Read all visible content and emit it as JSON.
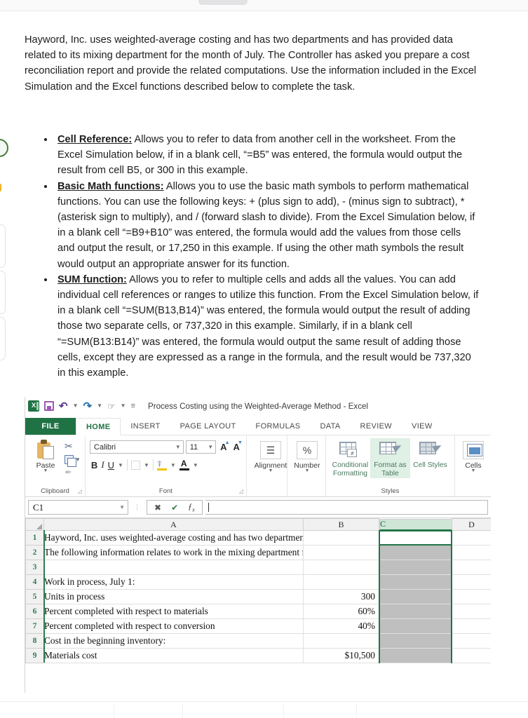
{
  "intro": {
    "paragraph": "Hayword, Inc. uses weighted-average costing and has two departments and has provided data related to its mixing department for the month of July.  The Controller has asked you prepare a cost reconciliation report and provide the related computations.  Use the information included in the Excel Simulation and the Excel functions described below to complete the task."
  },
  "bullets": [
    {
      "term": "Cell Reference:",
      "text": " Allows you to refer to data from another cell in the worksheet.  From the Excel Simulation below, if in a blank cell, “=B5” was entered, the formula would output the result from cell B5, or 300 in this example."
    },
    {
      "term": "Basic Math functions:",
      "text": " Allows you to use the basic math symbols to perform mathematical functions.  You can use the following keys:  + (plus sign to add), - (minus sign to subtract), * (asterisk sign to multiply), and / (forward slash to divide).  From the Excel Simulation below, if in a blank cell “=B9+B10” was entered, the formula would add the values from those cells and output the result, or 17,250 in this example.  If using the other math symbols the result would output an appropriate answer for its function."
    },
    {
      "term": "SUM function:",
      "text": " Allows you to refer to multiple cells and adds all the values.  You can add individual cell references or ranges to utilize this function.  From the Excel Simulation below, if in a blank cell “=SUM(B13,B14)” was entered, the formula would output the result of adding those two separate cells, or 737,320 in this example.  Similarly, if in a blank cell “=SUM(B13:B14)” was entered, the formula would output the same result of adding those cells, except they are expressed as a range in the formula, and the result would be 737,320 in this example."
    }
  ],
  "excel": {
    "title": "Process Costing using the Weighted-Average Method - Excel",
    "quick_access": {
      "app_icon": "excel-icon",
      "save": "save-icon",
      "undo": "undo-icon",
      "redo": "redo-icon",
      "touch_mode": "touch-mode-icon",
      "customize": "customize-icon"
    },
    "tabs": [
      {
        "label": "FILE",
        "active": false,
        "file": true
      },
      {
        "label": "HOME",
        "active": true,
        "file": false
      },
      {
        "label": "INSERT",
        "active": false,
        "file": false
      },
      {
        "label": "PAGE LAYOUT",
        "active": false,
        "file": false
      },
      {
        "label": "FORMULAS",
        "active": false,
        "file": false
      },
      {
        "label": "DATA",
        "active": false,
        "file": false
      },
      {
        "label": "REVIEW",
        "active": false,
        "file": false
      },
      {
        "label": "VIEW",
        "active": false,
        "file": false
      }
    ],
    "ribbon": {
      "clipboard": {
        "group_label": "Clipboard",
        "paste_label": "Paste",
        "cut_icon": "scissors-icon",
        "copy_icon": "copy-icon",
        "format_painter_icon": "format-painter-icon"
      },
      "font": {
        "group_label": "Font",
        "font_name": "Calibri",
        "font_size": "11",
        "grow_font": "A",
        "shrink_font": "A",
        "bold": "B",
        "italic": "I",
        "underline": "U",
        "borders_icon": "borders-icon",
        "fill_color_icon": "fill-color-icon",
        "font_color_icon": "font-color-icon"
      },
      "alignment": {
        "label": "Alignment",
        "icon": "alignment-icon"
      },
      "number": {
        "label": "Number",
        "icon": "percent-icon",
        "symbol": "%"
      },
      "styles": {
        "group_label": "Styles",
        "conditional_formatting": "Conditional Formatting",
        "format_as_table": "Format as Table",
        "cell_styles": "Cell Styles"
      },
      "cells": {
        "label": "Cells",
        "icon": "insert-cells-icon"
      }
    },
    "formula_bar": {
      "name_box": "C1",
      "cancel_icon": "cancel-icon",
      "enter_icon": "enter-icon",
      "insert_function_icon": "fx-icon",
      "value": ""
    },
    "sheet": {
      "columns": [
        "A",
        "B",
        "C",
        "D"
      ],
      "selected_column": "C",
      "active_cell": "C1",
      "rows": [
        {
          "n": "1",
          "a": "Hayword, Inc. uses weighted-average costing and has two departments, mixing and packaging.",
          "b": "",
          "c": "",
          "d": ""
        },
        {
          "n": "2",
          "a": "The following information relates to work in the mixing department for the month of July:",
          "b": "",
          "c": "",
          "d": ""
        },
        {
          "n": "3",
          "a": "",
          "b": "",
          "c": "",
          "d": ""
        },
        {
          "n": "4",
          "a": "Work in process, July 1:",
          "b": "",
          "c": "",
          "d": ""
        },
        {
          "n": "5",
          "a": "   Units in process",
          "b": "300",
          "c": "",
          "d": ""
        },
        {
          "n": "6",
          "a": "   Percent completed with respect to materials",
          "b": "60%",
          "c": "",
          "d": ""
        },
        {
          "n": "7",
          "a": "   Percent completed with respect to conversion",
          "b": "40%",
          "c": "",
          "d": ""
        },
        {
          "n": "8",
          "a": "   Cost in the beginning inventory:",
          "b": "",
          "c": "",
          "d": ""
        },
        {
          "n": "9",
          "a": "      Materials cost",
          "b": "$10,500",
          "c": "",
          "d": ""
        }
      ]
    }
  },
  "colors": {
    "excel_green": "#1f7244",
    "selection_green": "#217346",
    "selected_header": "#cfe6d6",
    "selected_column_fill": "#bfbfbf",
    "highlight_style": "#dff0e4"
  }
}
